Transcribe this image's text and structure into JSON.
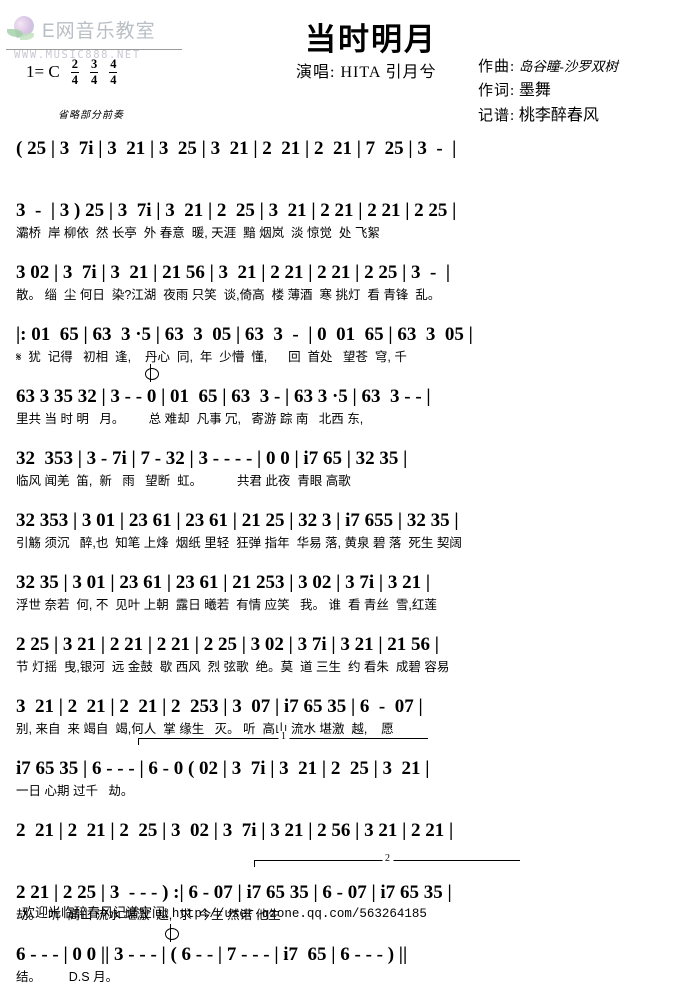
{
  "site": {
    "logo_text": "E网音乐教室",
    "watermark": "WWW.MUSIC888.NET"
  },
  "header": {
    "key_label": "1= C",
    "meters": [
      {
        "num": "2",
        "den": "4"
      },
      {
        "num": "3",
        "den": "4"
      },
      {
        "num": "4",
        "den": "4"
      }
    ],
    "title": "当时明月",
    "singer": "演唱: HITA 引月兮",
    "credits": [
      {
        "label": "作曲:",
        "value": "岛谷瞳-沙罗双树",
        "big": false
      },
      {
        "label": "作词:",
        "value": "墨舞",
        "big": true
      },
      {
        "label": "记谱:",
        "value": "桃李醉春风",
        "big": true
      }
    ]
  },
  "score": {
    "prelude_note": "省略部分前奏",
    "ds_label": "D.S",
    "lines": [
      {
        "id": "line-1",
        "notes": "( 25 | 3  7i | 3  21 | 3  25 | 3  21 | 2  21 | 2  21 | 7  25 | 3  -  |",
        "lyrics": ""
      },
      {
        "id": "line-2",
        "notes": "3  -  | 3 ) 25 | 3  7i | 3  21 | 2  25 | 3  21 | 2 21 | 2 21 | 2 25 |",
        "lyrics": "灞桥  岸 柳依  然 长亭  外 春意  暖, 天涯  黯 烟岚  淡 惊觉  处 飞絮"
      },
      {
        "id": "line-3",
        "notes": "3 02 | 3  7i | 3  21 | 21 56 | 3  21 | 2 21 | 2 21 | 2 25 | 3  -  |",
        "lyrics": "散。 缁  尘 何日  染?江湖  夜雨 只笑  谈,倚高  楼 薄酒  寒 挑灯  看 青锋  乱。"
      },
      {
        "id": "line-4",
        "notes": "|: 01  65 | 63  3 ·5 | 63  3  05 | 63  3  -  | 0  01  65 | 63  3  05 |",
        "lyrics": "𝄋  犹  记得   初相  逢,    丹心  同,  年  少懵  懂,      回  首处   望苍  穹, 千"
      },
      {
        "id": "line-5",
        "notes": "63 3 35 32 | 3 - - 0 | 01  65 | 63  3 - | 63 3 ·5 | 63  3 - - |",
        "lyrics": "里共 当 时 明   月。       总 难却  凡事 冗,   寄游 踪 南   北西 东,"
      },
      {
        "id": "line-6",
        "notes": "32  353 | 3 - 7i | 7 - 32 | 3 - - - - | 0 0 | i7 65 | 32 35 |",
        "lyrics": "临风 闻羌  笛,  新   雨   望断  虹。          共君 此夜  青眼 高歌"
      },
      {
        "id": "line-7",
        "notes": "32 353 | 3 01 | 23 61 | 23 61 | 21 25 | 32 3 | i7 655 | 32 35 |",
        "lyrics": "引觞 须沉   醉,也  知笔 上烽  烟纸 里轻  狂弹 指年  华易 落, 黄泉 碧 落  死生 契阔"
      },
      {
        "id": "line-8",
        "notes": "32 35 | 3 01 | 23 61 | 23 61 | 21 253 | 3 02 | 3 7i | 3 21 |",
        "lyrics": "浮世 奈若  何, 不  见叶 上朝  露日 曦若  有情 应笑   我。 谁  看 青丝  雪,红莲"
      },
      {
        "id": "line-9",
        "notes": "2 25 | 3 21 | 2 21 | 2 21 | 2 25 | 3 02 | 3 7i | 3 21 | 21 56 |",
        "lyrics": "节 灯摇  曳,银河  远 金鼓  歇 西风  烈 弦歌  绝。莫  道 三生  约 看朱  成碧 容易"
      },
      {
        "id": "line-10",
        "notes": "3  21 | 2  21 | 2  21 | 2  253 | 3  07 | i7 65 35 | 6  -  07 |",
        "lyrics": "别, 来自  来 竭自  竭,何人  掌 缘生   灭。 听  高山 流水 堪激  越,    愿"
      },
      {
        "id": "line-11",
        "notes": "i7 65 35 | 6 - - - | 6 - 0 ( 02 | 3  7i | 3  21 | 2  25 | 3  21 |",
        "lyrics": "一日 心期 过千   劫。"
      },
      {
        "id": "line-12",
        "notes": "2  21 | 2  21 | 2  25 | 3  02 | 3  7i | 3 21 | 2 56 | 3 21 | 2 21 |",
        "lyrics": ""
      },
      {
        "id": "line-13",
        "notes": "2 21 | 2 25 | 3  - - - ) :| 6 - 07 | i7 65 35 | 6 - 07 | i7 65 35 |",
        "lyrics": "劫。  听  高山 流水 堪激  越,  求  今生 然诺 他生"
      },
      {
        "id": "line-14",
        "notes": "6 - - - | 0 0 || 3 - - - | ( 6 - - | 7 - - - | i7  65 | 6 - - - ) ||",
        "lyrics": "结。        D.S 月。"
      }
    ],
    "endings": [
      {
        "num": "1"
      },
      {
        "num": "2"
      }
    ]
  },
  "footer": {
    "text": "欢迎光临醉春风记谱空间:",
    "url": "http://user.qzone.qq.com/563264185"
  }
}
